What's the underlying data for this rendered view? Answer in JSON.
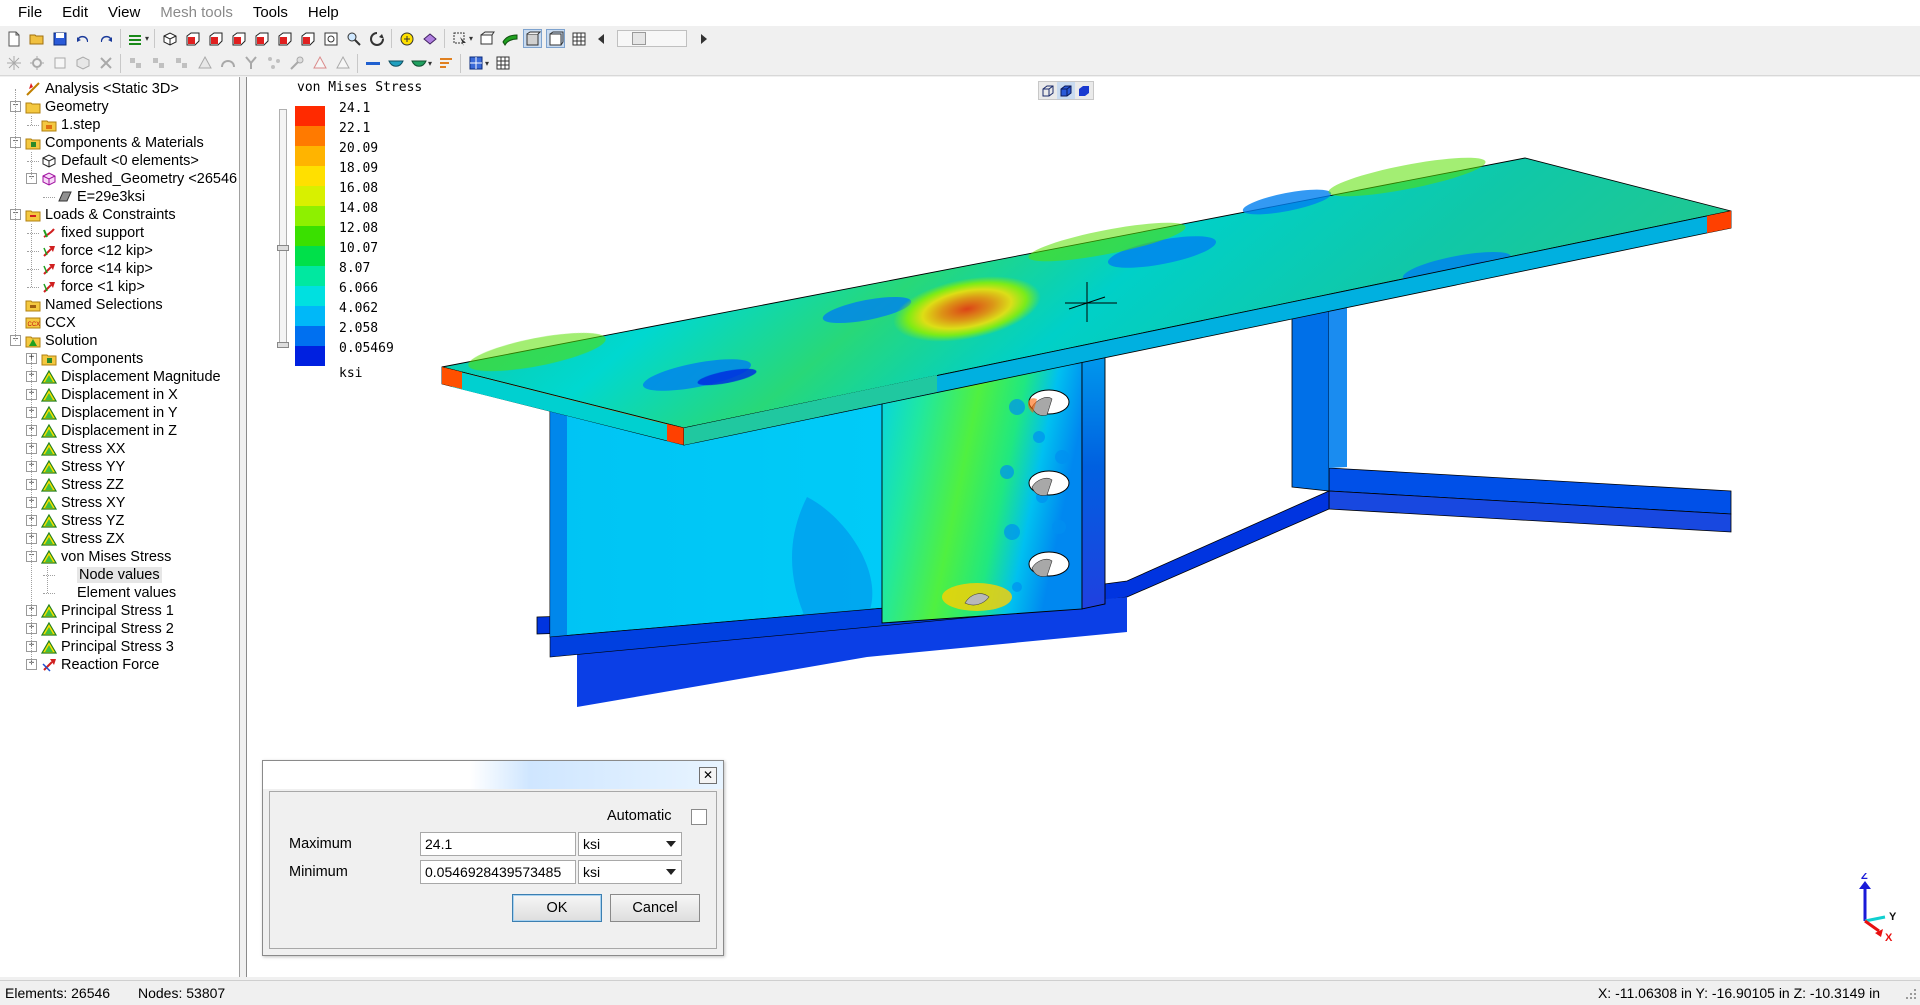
{
  "menu": {
    "items": [
      {
        "label": "File",
        "enabled": true
      },
      {
        "label": "Edit",
        "enabled": true
      },
      {
        "label": "View",
        "enabled": true
      },
      {
        "label": "Mesh tools",
        "enabled": false
      },
      {
        "label": "Tools",
        "enabled": true
      },
      {
        "label": "Help",
        "enabled": true
      }
    ]
  },
  "toolbar1": {
    "icons": [
      "new-file-icon",
      "open-folder-icon",
      "save-icon",
      "undo-icon",
      "redo-icon",
      "layers-dropdown-icon",
      "view-iso-icon",
      "view-front-icon",
      "view-back-icon",
      "view-left-icon",
      "view-right-icon",
      "view-top-icon",
      "view-bottom-icon",
      "zoom-fit-icon",
      "zoom-icon",
      "rotate-icon",
      "pan-icon",
      "select-mode-icon",
      "cursor-dropdown-icon",
      "box-select-icon",
      "surface-icon",
      "shaded-icon",
      "wireframe-edges-icon",
      "mesh-icon",
      "slider-left-icon",
      "slider-right-icon"
    ]
  },
  "toolbar2": {
    "icons": [
      "snowflake-icon",
      "gear-sun-icon",
      "rect-icon",
      "cube-icon",
      "delete-icon",
      "node-icon",
      "node2-icon",
      "node3-icon",
      "cone-icon",
      "arc-icon",
      "fork-icon",
      "scatter-icon",
      "probe-icon",
      "triangle-red-icon",
      "triangle-icon",
      "beam-icon",
      "bowl-icon",
      "bowl-green-icon",
      "sort-icon",
      "grid-icon",
      "table-icon"
    ]
  },
  "tree": {
    "items": [
      {
        "label": "Analysis <Static 3D>",
        "level": 0,
        "icon": "analysis-icon",
        "expander": ""
      },
      {
        "label": "Geometry",
        "level": 0,
        "icon": "folder-icon",
        "expander": "-"
      },
      {
        "label": "1.step",
        "level": 1,
        "icon": "step-file-icon",
        "expander": ""
      },
      {
        "label": "Components & Materials",
        "level": 0,
        "icon": "components-icon",
        "expander": "-"
      },
      {
        "label": "Default <0 elements>",
        "level": 1,
        "icon": "mesh-part-icon",
        "expander": ""
      },
      {
        "label": "Meshed_Geometry <26546",
        "level": 1,
        "icon": "mesh-part-magenta-icon",
        "expander": "-"
      },
      {
        "label": "E=29e3ksi",
        "level": 2,
        "icon": "material-icon",
        "expander": ""
      },
      {
        "label": "Loads & Constraints",
        "level": 0,
        "icon": "loads-folder-icon",
        "expander": "-"
      },
      {
        "label": "fixed support",
        "level": 1,
        "icon": "support-icon",
        "expander": ""
      },
      {
        "label": "force <12 kip>",
        "level": 1,
        "icon": "force-icon",
        "expander": ""
      },
      {
        "label": "force <14 kip>",
        "level": 1,
        "icon": "force-icon",
        "expander": ""
      },
      {
        "label": "force <1 kip>",
        "level": 1,
        "icon": "force-icon",
        "expander": ""
      },
      {
        "label": "Named Selections",
        "level": 0,
        "icon": "named-selection-icon",
        "expander": ""
      },
      {
        "label": "CCX",
        "level": 0,
        "icon": "ccx-icon",
        "expander": ""
      },
      {
        "label": "Solution",
        "level": 0,
        "icon": "solution-icon",
        "expander": "-"
      },
      {
        "label": "Components",
        "level": 1,
        "icon": "components-icon",
        "expander": "+"
      },
      {
        "label": "Displacement Magnitude",
        "level": 1,
        "icon": "result-icon",
        "expander": "+"
      },
      {
        "label": "Displacement in X",
        "level": 1,
        "icon": "result-icon",
        "expander": "+"
      },
      {
        "label": "Displacement in Y",
        "level": 1,
        "icon": "result-icon",
        "expander": "+"
      },
      {
        "label": "Displacement in Z",
        "level": 1,
        "icon": "result-icon",
        "expander": "+"
      },
      {
        "label": "Stress XX",
        "level": 1,
        "icon": "result-icon",
        "expander": "+"
      },
      {
        "label": "Stress YY",
        "level": 1,
        "icon": "result-icon",
        "expander": "+"
      },
      {
        "label": "Stress ZZ",
        "level": 1,
        "icon": "result-icon",
        "expander": "+"
      },
      {
        "label": "Stress XY",
        "level": 1,
        "icon": "result-icon",
        "expander": "+"
      },
      {
        "label": "Stress YZ",
        "level": 1,
        "icon": "result-icon",
        "expander": "+"
      },
      {
        "label": "Stress ZX",
        "level": 1,
        "icon": "result-icon",
        "expander": "+"
      },
      {
        "label": "von Mises Stress",
        "level": 1,
        "icon": "result-icon",
        "expander": "-"
      },
      {
        "label": "Node values",
        "level": 2,
        "icon": "",
        "expander": "",
        "selected": true
      },
      {
        "label": "Element values",
        "level": 2,
        "icon": "",
        "expander": ""
      },
      {
        "label": "Principal Stress 1",
        "level": 1,
        "icon": "result-icon",
        "expander": "+"
      },
      {
        "label": "Principal Stress 2",
        "level": 1,
        "icon": "result-icon",
        "expander": "+"
      },
      {
        "label": "Principal Stress 3",
        "level": 1,
        "icon": "result-icon",
        "expander": "+"
      },
      {
        "label": "Reaction Force",
        "level": 1,
        "icon": "reaction-force-icon",
        "expander": "+"
      }
    ]
  },
  "legend": {
    "title": "von Mises Stress",
    "unit": "ksi",
    "labels": [
      "24.1",
      "22.1",
      "20.09",
      "18.09",
      "16.08",
      "14.08",
      "12.08",
      "10.07",
      "8.07",
      "6.066",
      "4.062",
      "2.058",
      "0.05469"
    ],
    "colors": [
      "#ff2a00",
      "#ff7a00",
      "#ffb400",
      "#ffe000",
      "#d8f000",
      "#8ef000",
      "#3ae000",
      "#00e04a",
      "#00e8a0",
      "#00e0e0",
      "#00b8f8",
      "#0070f0",
      "#0020e0"
    ]
  },
  "axes": {
    "x": "X",
    "y": "Y",
    "z": "Z"
  },
  "dialog": {
    "automatic_label": "Automatic",
    "automatic_checked": false,
    "maximum_label": "Maximum",
    "maximum_value": "24.1",
    "maximum_unit": "ksi",
    "minimum_label": "Minimum",
    "minimum_value": "0.0546928439573485",
    "minimum_unit": "ksi",
    "ok_label": "OK",
    "cancel_label": "Cancel",
    "close_glyph": "✕"
  },
  "status": {
    "elements": "Elements:  26546",
    "nodes": "Nodes: 53807",
    "coords": "X: -11.06308 in Y: -16.90105 in Z: -10.3149 in"
  },
  "scrollbar": {
    "left_arrow": "◀",
    "right_arrow": "▶",
    "grip": "|||"
  }
}
